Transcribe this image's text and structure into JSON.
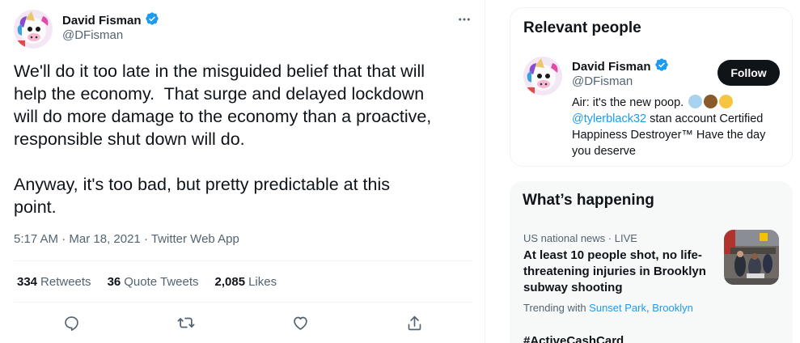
{
  "tweet": {
    "author_name": "David Fisman",
    "author_handle": "@DFisman",
    "more_label": "···",
    "text": "We'll do it too late in the misguided belief that that will\nhelp the economy.  That surge and delayed lockdown\nwill do more damage to the economy than a proactive,\nresponsible shut down will do.\n\nAnyway, it's too bad, but pretty predictable at this\npoint.",
    "time": "5:17 AM",
    "date": "Mar 18, 2021",
    "separator": " · ",
    "client": "Twitter Web App",
    "stats": {
      "retweets_count": "334",
      "retweets_label": "Retweets",
      "quotes_count": "36",
      "quotes_label": "Quote Tweets",
      "likes_count": "2,085",
      "likes_label": "Likes"
    }
  },
  "relevant_people": {
    "title": "Relevant people",
    "name": "David Fisman",
    "handle": "@DFisman",
    "follow_label": "Follow",
    "bio_part1": "Air: it's the new poop. ",
    "bio_mention": "@tylerblack32",
    "bio_part2": " stan account Certified Happiness Destroyer™ Have the day you deserve"
  },
  "whats_happening": {
    "title": "What’s happening",
    "trend_meta": "US national news · LIVE",
    "trend_title": "At least 10 people shot, no life-threatening injuries in Brooklyn subway shooting",
    "trending_with_label": "Trending with ",
    "trending_with_1": "Sunset Park",
    "trending_with_sep": ", ",
    "trending_with_2": "Brooklyn",
    "next_trend": "#ActiveCashCard"
  },
  "colors": {
    "accent": "#1d9bf0",
    "text": "#0f1419",
    "secondary": "#536471",
    "verified": "#1d9bf0"
  },
  "icons": [
    "verified-badge-icon",
    "more-icon",
    "reply-icon",
    "retweet-icon",
    "like-icon",
    "share-icon"
  ]
}
